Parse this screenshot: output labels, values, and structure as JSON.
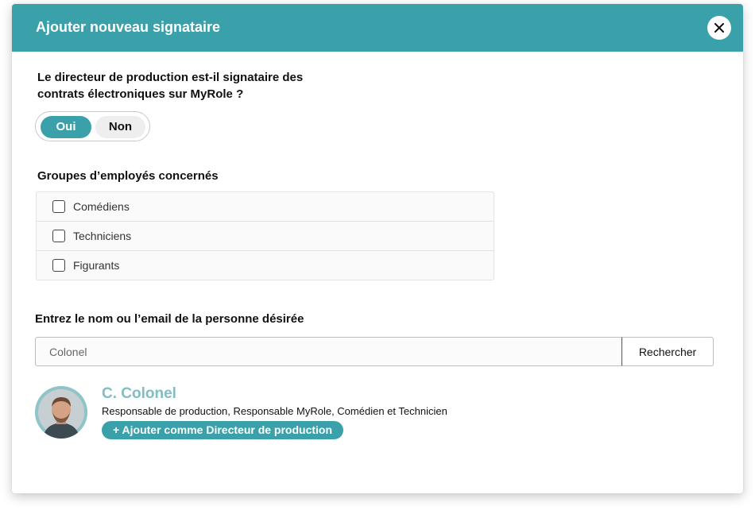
{
  "modal": {
    "title": "Ajouter nouveau signataire",
    "close_icon": "close-icon"
  },
  "signatory_question": {
    "text": "Le directeur de production est-il signataire des contrats électroniques sur MyRole ?",
    "options": [
      "Oui",
      "Non"
    ],
    "selected": "Oui"
  },
  "employee_groups": {
    "label": "Groupes d’employés concernés",
    "items": [
      {
        "label": "Comédiens",
        "checked": false
      },
      {
        "label": "Techniciens",
        "checked": false
      },
      {
        "label": "Figurants",
        "checked": false
      }
    ]
  },
  "search": {
    "label": "Entrez le nom ou l’email de la personne désirée",
    "value": "Colonel",
    "button_label": "Rechercher"
  },
  "result": {
    "name": "C. Colonel",
    "roles": "Responsable de production, Responsable MyRole, Comédien et Technicien",
    "add_button_label": "+ Ajouter comme Directeur de production"
  },
  "colors": {
    "accent": "#3aa0aa",
    "name_link": "#7fbec4"
  }
}
